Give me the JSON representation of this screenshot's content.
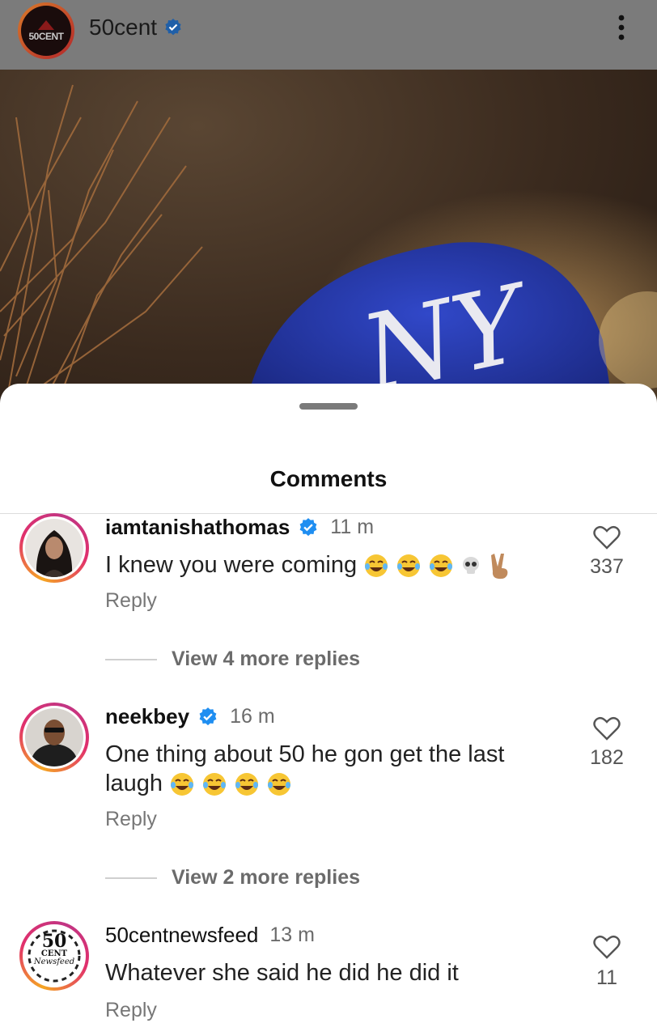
{
  "header": {
    "username": "50cent",
    "avatar_text": "50CENT"
  },
  "sheet": {
    "title": "Comments"
  },
  "comments": [
    {
      "username": "iamtanishathomas",
      "verified": true,
      "time": "11 m",
      "text": "I knew you were coming",
      "emojis": [
        "laughing-tears",
        "laughing-tears",
        "laughing-tears",
        "skull",
        "victory-hand"
      ],
      "reply_label": "Reply",
      "likes": "337",
      "more_replies": "View 4 more replies"
    },
    {
      "username": "neekbey",
      "verified": true,
      "time": "16 m",
      "text_line1": "One thing about 50 he gon get the last",
      "text_line2": "laugh",
      "emojis": [
        "laughing-tears",
        "laughing-tears",
        "laughing-tears",
        "laughing-tears"
      ],
      "reply_label": "Reply",
      "likes": "182",
      "more_replies": "View 2 more replies"
    },
    {
      "username": "50centnewsfeed",
      "verified": false,
      "time": "13 m",
      "text": "Whatever she said he did he did it",
      "reply_label": "Reply",
      "likes": "11",
      "avatar_text_top": "50",
      "avatar_text_mid": "CENT",
      "avatar_text_bottom": "Newsfeed"
    }
  ],
  "colors": {
    "verified": "#1f8ef1",
    "cap_blue": "#2a3fb8",
    "story_ring_start": "#f5a623",
    "story_ring_end": "#c13584"
  }
}
